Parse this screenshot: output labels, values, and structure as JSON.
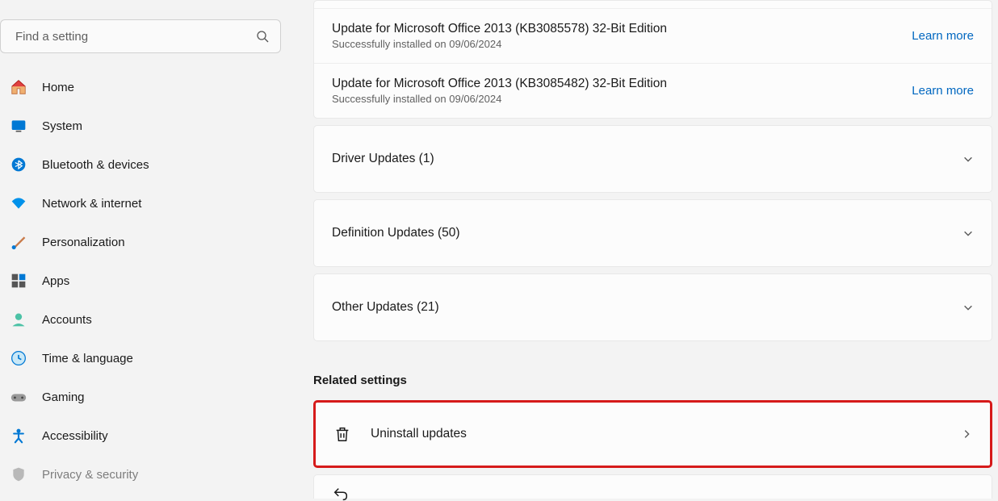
{
  "search": {
    "placeholder": "Find a setting"
  },
  "nav": {
    "items": [
      {
        "label": "Home"
      },
      {
        "label": "System"
      },
      {
        "label": "Bluetooth & devices"
      },
      {
        "label": "Network & internet"
      },
      {
        "label": "Personalization"
      },
      {
        "label": "Apps"
      },
      {
        "label": "Accounts"
      },
      {
        "label": "Time & language"
      },
      {
        "label": "Gaming"
      },
      {
        "label": "Accessibility"
      },
      {
        "label": "Privacy & security"
      }
    ]
  },
  "updates": [
    {
      "name": "Update for Microsoft Office 2013 (KB3085578) 32-Bit Edition",
      "status": "Successfully installed on 09/06/2024",
      "link": "Learn more"
    },
    {
      "name": "Update for Microsoft Office 2013 (KB3085482) 32-Bit Edition",
      "status": "Successfully installed on 09/06/2024",
      "link": "Learn more"
    }
  ],
  "expanders": [
    {
      "label": "Driver Updates (1)"
    },
    {
      "label": "Definition Updates (50)"
    },
    {
      "label": "Other Updates (21)"
    }
  ],
  "related": {
    "header": "Related settings",
    "uninstall": "Uninstall updates"
  }
}
